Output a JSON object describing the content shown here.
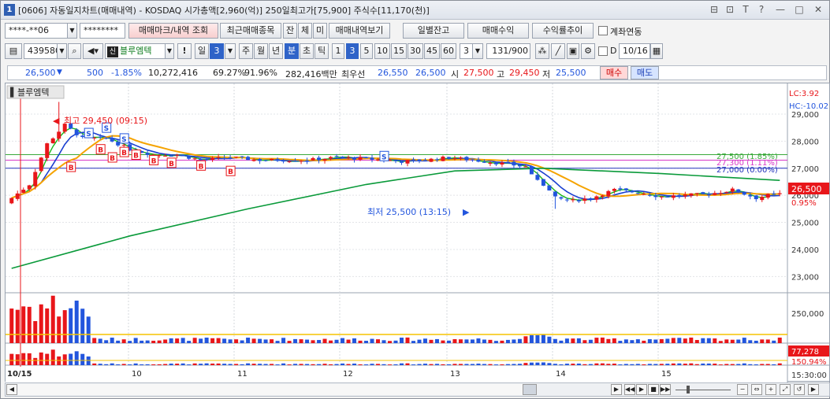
{
  "titlebar": {
    "number": "1",
    "title": "[0606] 자동일지차트(매매내역) - KOSDAQ 시가총액[2,960(억)] 250일최고가[75,900] 주식수[11,170(천)]",
    "controls": [
      "⊟",
      "⊡",
      "T",
      "?",
      "—",
      "□",
      "✕"
    ]
  },
  "toolbar1": {
    "account": "****-**06",
    "password": "********",
    "btn_trade_mark": "매매마크/내역 조회",
    "btn_recent": "최근매매종목",
    "btn_jan": "잔",
    "btn_che": "체",
    "btn_mi": "미",
    "btn_history": "매매내역보기",
    "btn_daily_balance": "일별잔고",
    "btn_profit": "매매수익",
    "btn_return_trend": "수익률추이",
    "link_account_label": "계좌연동"
  },
  "toolbar2": {
    "code": "439580",
    "name": "블루엠텍",
    "exclaim": "!",
    "period_il": "일",
    "period_value": "3",
    "period_ju": "주",
    "period_wol": "월",
    "period_nyeon": "년",
    "period_bun": "분",
    "period_cho": "초",
    "period_tik": "틱",
    "intervals": [
      "1",
      "3",
      "5",
      "10",
      "15",
      "30",
      "45",
      "60"
    ],
    "interval_value": "3",
    "count_value": "131",
    "count_total": "/900",
    "d_label": "D",
    "date_value": "10/16"
  },
  "quote": {
    "price": "26,500",
    "change": "500",
    "change_pct": "-1.85%",
    "volume": "10,272,416",
    "ratio1": "69.27%",
    "ratio2": "91.96%",
    "amount": "282,416백만",
    "best_label": "최우선",
    "best_ask": "26,550",
    "best_bid": "26,500",
    "open_label": "시",
    "open": "27,500",
    "high_label": "고",
    "high": "29,450",
    "low_label": "저",
    "low": "25,500",
    "buy_btn": "매수",
    "sell_btn": "매도"
  },
  "chart": {
    "legend_name": "블루엠텍",
    "lc_label": "LC:3.92",
    "hc_label": "HC:-10.02",
    "high_annotation": "최고 29,450 (09:15)",
    "low_annotation": "최저 25,500 (13:15)",
    "hline_labels": [
      "27,500 (1.85%)",
      "27,300 (1.11%)",
      "27,000 (0.00%)"
    ],
    "current_price_tag": "26,500",
    "current_pct": "0.95%",
    "volume_axis_label": "250,000",
    "volume_tag": "77,278",
    "volume_pct": "150.94%",
    "time_readout": "15:30:00",
    "date_labels": [
      "10/15",
      "10",
      "11",
      "12",
      "13",
      "14",
      "15"
    ]
  },
  "chart_data": {
    "type": "candlestick",
    "y_axis_ticks": [
      29000,
      28000,
      27000,
      26000,
      25000,
      24000,
      23000
    ],
    "ylim": [
      22400,
      29900
    ],
    "annotations": {
      "high": 29450,
      "low": 25500,
      "current": 26500
    },
    "horizontal_lines": [
      27500,
      27300,
      27000
    ],
    "candles_count": 131
  },
  "colors": {
    "up": "#e8161a",
    "down": "#2255dd",
    "ma_short": "#19b819",
    "ma_mid": "#1a3fd0",
    "ma_long": "#f5a300",
    "ma_very_long": "#0a9a3a",
    "line_pink": "#d837c8",
    "line_green": "#3aa93a",
    "line_blue": "#2233bb"
  }
}
